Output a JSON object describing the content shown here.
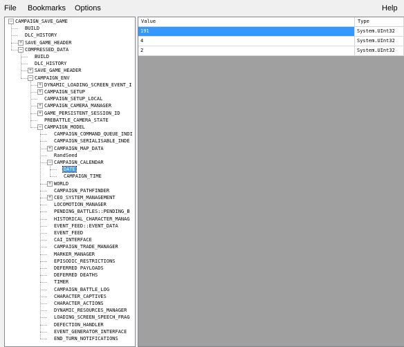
{
  "menu": {
    "file": "File",
    "bookmarks": "Bookmarks",
    "options": "Options",
    "help": "Help"
  },
  "tree": {
    "nodes": [
      {
        "label": "CAMPAIGN_SAVE_GAME",
        "expander": "minus"
      },
      {
        "label": "BUILD"
      },
      {
        "label": "DLC_HISTORY"
      },
      {
        "label": "SAVE_GAME_HEADER",
        "expander": "plus"
      },
      {
        "label": "COMPRESSED_DATA",
        "expander": "minus"
      },
      {
        "label": "BUILD"
      },
      {
        "label": "DLC_HISTORY"
      },
      {
        "label": "SAVE_GAME_HEADER",
        "expander": "plus"
      },
      {
        "label": "CAMPAIGN_ENV",
        "expander": "minus"
      },
      {
        "label": "DYNAMIC_LOADING_SCREEN_EVENT_I",
        "expander": "plus"
      },
      {
        "label": "CAMPAIGN_SETUP",
        "expander": "plus"
      },
      {
        "label": "CAMPAIGN_SETUP_LOCAL"
      },
      {
        "label": "CAMPAIGN_CAMERA_MANAGER",
        "expander": "plus"
      },
      {
        "label": "GAME_PERSISTENT_SESSION_ID",
        "expander": "plus"
      },
      {
        "label": "PREBATTLE_CAMERA_STATE"
      },
      {
        "label": "CAMPAIGN_MODEL",
        "expander": "minus"
      },
      {
        "label": "CAMPAIGN_COMMAND_QUEUE_INDI"
      },
      {
        "label": "CAMPAIGN_SERIALISABLE_INDE"
      },
      {
        "label": "CAMPAIGN_MAP_DATA",
        "expander": "plus"
      },
      {
        "label": "RandSeed"
      },
      {
        "label": "CAMPAIGN_CALENDAR",
        "expander": "minus"
      },
      {
        "label": "DATE",
        "selected": true
      },
      {
        "label": "CAMPAIGN_TIME"
      },
      {
        "label": "WORLD",
        "expander": "plus"
      },
      {
        "label": "CAMPAIGN_PATHFINDER"
      },
      {
        "label": "CEO_SYSTEM_MANAGEMENT",
        "expander": "plus"
      },
      {
        "label": "LOCOMOTION_MANAGER"
      },
      {
        "label": "PENDING_BATTLES::PENDING_B"
      },
      {
        "label": "HISTORICAL_CHARACTER_MANAG"
      },
      {
        "label": "EVENT_FEED::EVENT_DATA"
      },
      {
        "label": "EVENT_FEED"
      },
      {
        "label": "CAI_INTERFACE"
      },
      {
        "label": "CAMPAIGN_TRADE_MANAGER"
      },
      {
        "label": "MARKER_MANAGER"
      },
      {
        "label": "EPISODIC_RESTRICTIONS"
      },
      {
        "label": "DEFERRED PAYLOADS"
      },
      {
        "label": "DEFERRED DEATHS"
      },
      {
        "label": "TIMER"
      },
      {
        "label": "CAMPAIGN_BATTLE_LOG"
      },
      {
        "label": "CHARACTER_CAPTIVES"
      },
      {
        "label": "CHARACTER_ACTIONS"
      },
      {
        "label": "DYNAMIC_RESOURCES_MANAGER"
      },
      {
        "label": "LOADING_SCREEN_SPEECH_FRAG"
      },
      {
        "label": "DEFECTION_HANDLER"
      },
      {
        "label": "EVENT_GENERATOR_INTERFACE"
      },
      {
        "label": "END_TURN_NOTIFICATIONS"
      }
    ]
  },
  "grid": {
    "headers": {
      "value": "Value",
      "type": "Type"
    },
    "rows": [
      {
        "value": "191",
        "type": "System.UInt32"
      },
      {
        "value": "4",
        "type": "System.UInt32"
      },
      {
        "value": "2",
        "type": "System.UInt32"
      }
    ]
  }
}
